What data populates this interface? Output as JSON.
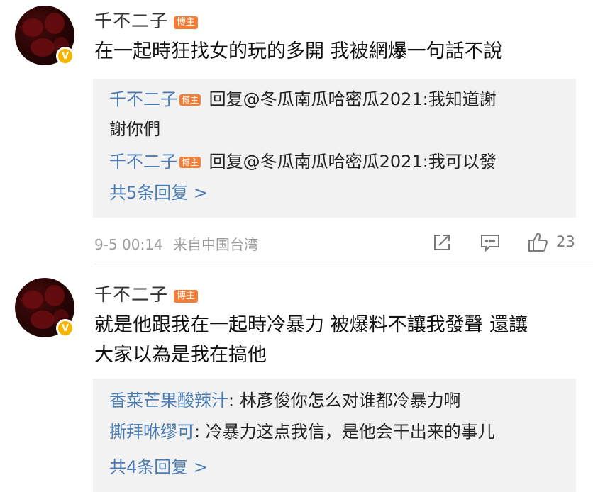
{
  "posts": [
    {
      "username": "千不二子",
      "tag": "博主",
      "content": "在一起時狂找女的玩的多開 我被網爆一句話不說",
      "replies": [
        {
          "author": "千不二子",
          "tag": "博主",
          "text_pre": " 回复@冬瓜南瓜哈密瓜2021:我知道謝",
          "text_cont": "謝你們"
        },
        {
          "author": "千不二子",
          "tag": "博主",
          "text_pre": " 回复@冬瓜南瓜哈密瓜2021:我可以發"
        }
      ],
      "more_replies": "共5条回复 >",
      "timestamp": "9-5 00:14",
      "source": "来自中国台湾",
      "like_count": "23"
    },
    {
      "username": "千不二子",
      "tag": "博主",
      "content_line1": "就是他跟我在一起時冷暴力 被爆料不讓我發聲 還讓",
      "content_line2": "大家以為是我在搞他",
      "replies": [
        {
          "author": "香菜芒果酸辣汁",
          "text": ": 林彥俊你怎么对谁都冷暴力啊"
        },
        {
          "author": "撕拜咻缪可",
          "text": ": 冷暴力这点我信，是他会干出来的事儿"
        }
      ],
      "more_replies": "共4条回复 >"
    }
  ],
  "icons": {
    "verified": "verified-v-badge",
    "share": "share-icon",
    "comment": "comment-icon",
    "like": "thumbs-up-icon"
  },
  "colors": {
    "link_blue": "#4b7db4",
    "tag_orange": "#f27e3a",
    "verified_gold": "#f7b500",
    "reply_bg": "#f2f2f2",
    "meta_gray": "#9b9b9b"
  }
}
